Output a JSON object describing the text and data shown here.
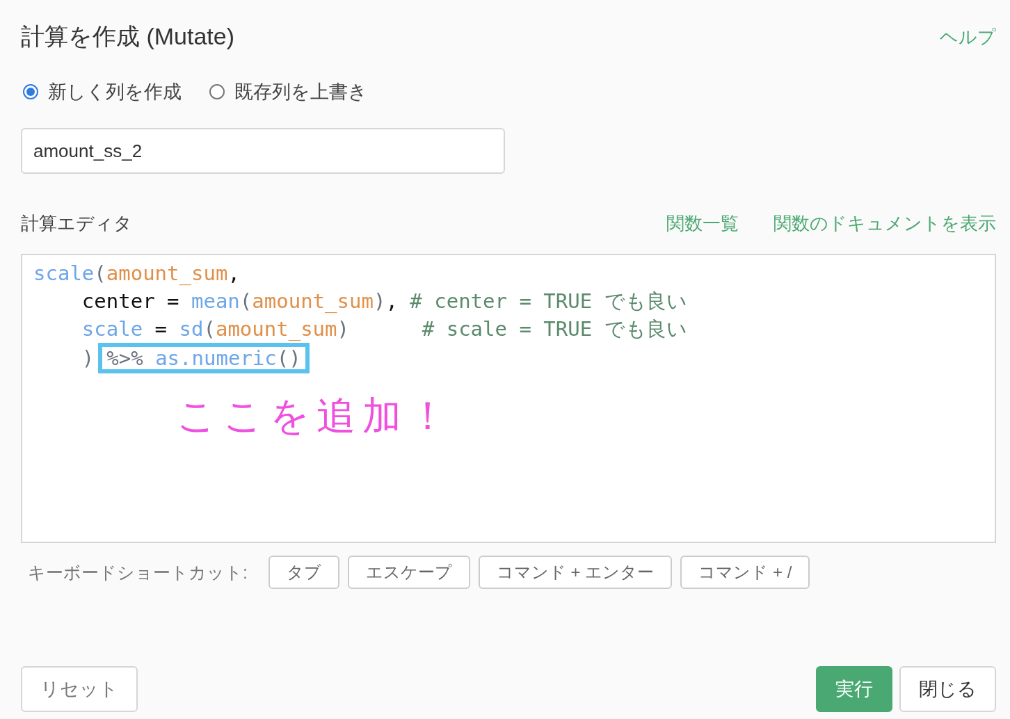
{
  "dialog": {
    "title": "計算を作成 (Mutate)",
    "help_link": "ヘルプ"
  },
  "mode_options": [
    {
      "label": "新しく列を作成",
      "selected": true
    },
    {
      "label": "既存列を上書き",
      "selected": false
    }
  ],
  "column_name": {
    "value": "amount_ss_2"
  },
  "editor": {
    "label": "計算エディタ",
    "links": [
      "関数一覧",
      "関数のドキュメントを表示"
    ],
    "lines": [
      {
        "tokens": [
          {
            "kind": "function",
            "text": "scale"
          },
          {
            "kind": "punct",
            "text": "("
          },
          {
            "kind": "variable",
            "text": "amount_sum"
          },
          {
            "kind": "plain",
            "text": ","
          }
        ]
      },
      {
        "tokens": [
          {
            "kind": "plain",
            "text": "    center = "
          },
          {
            "kind": "function",
            "text": "mean"
          },
          {
            "kind": "punct",
            "text": "("
          },
          {
            "kind": "variable",
            "text": "amount_sum"
          },
          {
            "kind": "punct",
            "text": ")"
          },
          {
            "kind": "plain",
            "text": ", "
          },
          {
            "kind": "comment",
            "text": "# center = TRUE でも良い"
          }
        ]
      },
      {
        "tokens": [
          {
            "kind": "function",
            "text": "    scale"
          },
          {
            "kind": "plain",
            "text": " = "
          },
          {
            "kind": "function",
            "text": "sd"
          },
          {
            "kind": "punct",
            "text": "("
          },
          {
            "kind": "variable",
            "text": "amount_sum"
          },
          {
            "kind": "punct",
            "text": ")"
          },
          {
            "kind": "comment",
            "text": "      # scale = TRUE でも良い"
          }
        ]
      },
      {
        "tokens": [
          {
            "kind": "punct",
            "text": "    )"
          }
        ],
        "highlight": [
          {
            "kind": "punct",
            "text": "%>%"
          },
          {
            "kind": "function",
            "text": " as.numeric"
          },
          {
            "kind": "punct",
            "text": "()"
          }
        ]
      }
    ],
    "annotation": "ここを追加！"
  },
  "shortcuts": {
    "label": "キーボードショートカット:",
    "keys": [
      "タブ",
      "エスケープ",
      "コマンド + エンター",
      "コマンド + /"
    ]
  },
  "buttons": [
    {
      "label": "リセット",
      "kind": "secondary"
    },
    {
      "label": "実行",
      "kind": "primary"
    },
    {
      "label": "閉じる",
      "kind": "secondary"
    }
  ]
}
